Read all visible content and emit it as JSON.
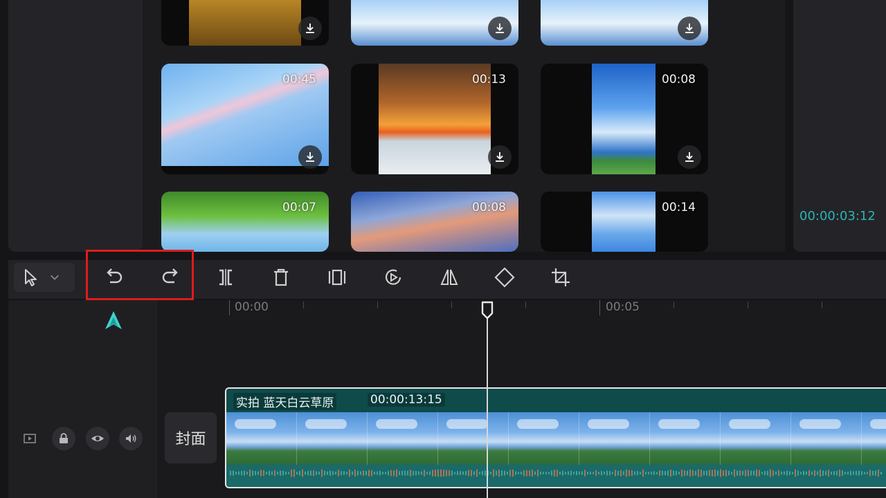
{
  "media": {
    "cards": [
      {
        "duration": "",
        "row": 0,
        "col": 0,
        "theme": "sparkle",
        "download": true
      },
      {
        "duration": "",
        "row": 0,
        "col": 1,
        "theme": "sky",
        "download": true
      },
      {
        "duration": "",
        "row": 0,
        "col": 2,
        "theme": "sky",
        "download": true
      },
      {
        "duration": "00:45",
        "row": 1,
        "col": 0,
        "theme": "rainbow",
        "download": true
      },
      {
        "duration": "00:13",
        "row": 1,
        "col": 1,
        "theme": "sunset",
        "download": true
      },
      {
        "duration": "00:08",
        "row": 1,
        "col": 2,
        "theme": "clouds",
        "download": true
      },
      {
        "duration": "00:07",
        "row": 2,
        "col": 0,
        "theme": "tree",
        "download": false
      },
      {
        "duration": "00:08",
        "row": 2,
        "col": 1,
        "theme": "dusk",
        "download": false
      },
      {
        "duration": "00:14",
        "row": 2,
        "col": 2,
        "theme": "clouds2",
        "download": false
      }
    ]
  },
  "preview": {
    "timecode": "00:00:03:12"
  },
  "toolbar": {
    "tools": [
      "select-arrow",
      "undo",
      "redo",
      "split",
      "delete",
      "freeze-frame",
      "reverse",
      "mirror",
      "rotate",
      "crop"
    ]
  },
  "timeline": {
    "ruler_labels": [
      "00:00",
      "00:05"
    ],
    "cover_label": "封面",
    "clip": {
      "name": "实拍 蓝天白云草原",
      "duration": "00:00:13:15"
    }
  },
  "colors": {
    "accent": "#2ab5b5",
    "highlight": "#e01b1b",
    "clip": "#135454"
  }
}
